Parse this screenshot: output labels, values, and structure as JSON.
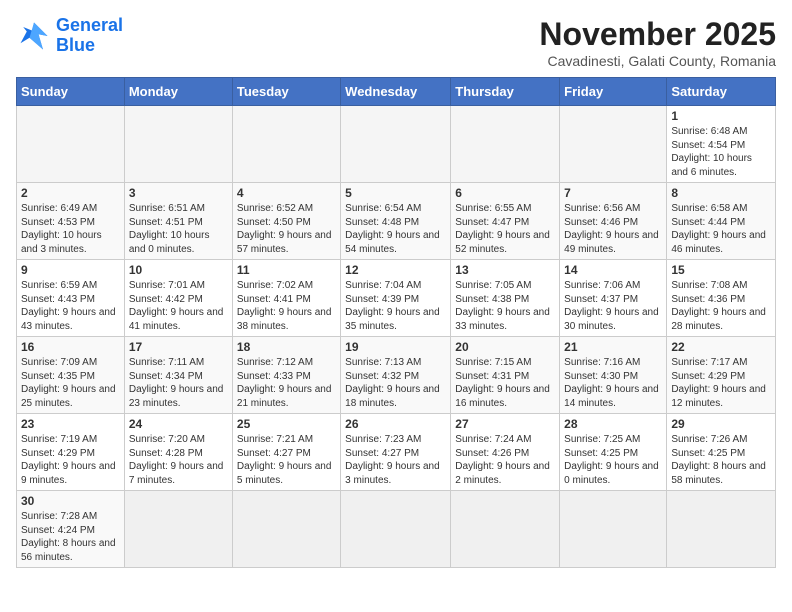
{
  "logo": {
    "line1": "General",
    "line2": "Blue"
  },
  "title": "November 2025",
  "location": "Cavadinesti, Galati County, Romania",
  "days_of_week": [
    "Sunday",
    "Monday",
    "Tuesday",
    "Wednesday",
    "Thursday",
    "Friday",
    "Saturday"
  ],
  "weeks": [
    [
      {
        "day": "",
        "info": ""
      },
      {
        "day": "",
        "info": ""
      },
      {
        "day": "",
        "info": ""
      },
      {
        "day": "",
        "info": ""
      },
      {
        "day": "",
        "info": ""
      },
      {
        "day": "",
        "info": ""
      },
      {
        "day": "1",
        "info": "Sunrise: 6:48 AM\nSunset: 4:54 PM\nDaylight: 10 hours and 6 minutes."
      }
    ],
    [
      {
        "day": "2",
        "info": "Sunrise: 6:49 AM\nSunset: 4:53 PM\nDaylight: 10 hours and 3 minutes."
      },
      {
        "day": "3",
        "info": "Sunrise: 6:51 AM\nSunset: 4:51 PM\nDaylight: 10 hours and 0 minutes."
      },
      {
        "day": "4",
        "info": "Sunrise: 6:52 AM\nSunset: 4:50 PM\nDaylight: 9 hours and 57 minutes."
      },
      {
        "day": "5",
        "info": "Sunrise: 6:54 AM\nSunset: 4:48 PM\nDaylight: 9 hours and 54 minutes."
      },
      {
        "day": "6",
        "info": "Sunrise: 6:55 AM\nSunset: 4:47 PM\nDaylight: 9 hours and 52 minutes."
      },
      {
        "day": "7",
        "info": "Sunrise: 6:56 AM\nSunset: 4:46 PM\nDaylight: 9 hours and 49 minutes."
      },
      {
        "day": "8",
        "info": "Sunrise: 6:58 AM\nSunset: 4:44 PM\nDaylight: 9 hours and 46 minutes."
      }
    ],
    [
      {
        "day": "9",
        "info": "Sunrise: 6:59 AM\nSunset: 4:43 PM\nDaylight: 9 hours and 43 minutes."
      },
      {
        "day": "10",
        "info": "Sunrise: 7:01 AM\nSunset: 4:42 PM\nDaylight: 9 hours and 41 minutes."
      },
      {
        "day": "11",
        "info": "Sunrise: 7:02 AM\nSunset: 4:41 PM\nDaylight: 9 hours and 38 minutes."
      },
      {
        "day": "12",
        "info": "Sunrise: 7:04 AM\nSunset: 4:39 PM\nDaylight: 9 hours and 35 minutes."
      },
      {
        "day": "13",
        "info": "Sunrise: 7:05 AM\nSunset: 4:38 PM\nDaylight: 9 hours and 33 minutes."
      },
      {
        "day": "14",
        "info": "Sunrise: 7:06 AM\nSunset: 4:37 PM\nDaylight: 9 hours and 30 minutes."
      },
      {
        "day": "15",
        "info": "Sunrise: 7:08 AM\nSunset: 4:36 PM\nDaylight: 9 hours and 28 minutes."
      }
    ],
    [
      {
        "day": "16",
        "info": "Sunrise: 7:09 AM\nSunset: 4:35 PM\nDaylight: 9 hours and 25 minutes."
      },
      {
        "day": "17",
        "info": "Sunrise: 7:11 AM\nSunset: 4:34 PM\nDaylight: 9 hours and 23 minutes."
      },
      {
        "day": "18",
        "info": "Sunrise: 7:12 AM\nSunset: 4:33 PM\nDaylight: 9 hours and 21 minutes."
      },
      {
        "day": "19",
        "info": "Sunrise: 7:13 AM\nSunset: 4:32 PM\nDaylight: 9 hours and 18 minutes."
      },
      {
        "day": "20",
        "info": "Sunrise: 7:15 AM\nSunset: 4:31 PM\nDaylight: 9 hours and 16 minutes."
      },
      {
        "day": "21",
        "info": "Sunrise: 7:16 AM\nSunset: 4:30 PM\nDaylight: 9 hours and 14 minutes."
      },
      {
        "day": "22",
        "info": "Sunrise: 7:17 AM\nSunset: 4:29 PM\nDaylight: 9 hours and 12 minutes."
      }
    ],
    [
      {
        "day": "23",
        "info": "Sunrise: 7:19 AM\nSunset: 4:29 PM\nDaylight: 9 hours and 9 minutes."
      },
      {
        "day": "24",
        "info": "Sunrise: 7:20 AM\nSunset: 4:28 PM\nDaylight: 9 hours and 7 minutes."
      },
      {
        "day": "25",
        "info": "Sunrise: 7:21 AM\nSunset: 4:27 PM\nDaylight: 9 hours and 5 minutes."
      },
      {
        "day": "26",
        "info": "Sunrise: 7:23 AM\nSunset: 4:27 PM\nDaylight: 9 hours and 3 minutes."
      },
      {
        "day": "27",
        "info": "Sunrise: 7:24 AM\nSunset: 4:26 PM\nDaylight: 9 hours and 2 minutes."
      },
      {
        "day": "28",
        "info": "Sunrise: 7:25 AM\nSunset: 4:25 PM\nDaylight: 9 hours and 0 minutes."
      },
      {
        "day": "29",
        "info": "Sunrise: 7:26 AM\nSunset: 4:25 PM\nDaylight: 8 hours and 58 minutes."
      }
    ],
    [
      {
        "day": "30",
        "info": "Sunrise: 7:28 AM\nSunset: 4:24 PM\nDaylight: 8 hours and 56 minutes."
      },
      {
        "day": "",
        "info": ""
      },
      {
        "day": "",
        "info": ""
      },
      {
        "day": "",
        "info": ""
      },
      {
        "day": "",
        "info": ""
      },
      {
        "day": "",
        "info": ""
      },
      {
        "day": "",
        "info": ""
      }
    ]
  ]
}
